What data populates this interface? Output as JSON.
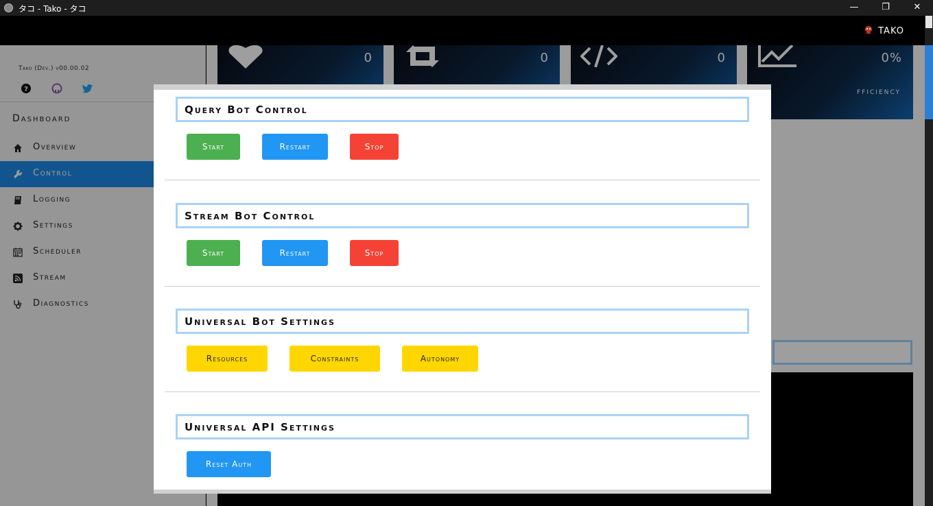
{
  "window": {
    "title": "タコ - Tako - タコ",
    "minimize": "—",
    "maximize": "❐",
    "close": "✕"
  },
  "topbar": {
    "brand": "TAKO"
  },
  "sidebar": {
    "version": "Tako (Dev.) v00.00.02",
    "dashboard_title": "Dashboard",
    "social_icons": [
      "help-icon",
      "github-icon",
      "twitter-icon"
    ],
    "items": [
      {
        "label": "Overview",
        "icon": "home-icon",
        "active": false
      },
      {
        "label": "Control",
        "icon": "wrench-icon",
        "active": true
      },
      {
        "label": "Logging",
        "icon": "book-icon",
        "active": false
      },
      {
        "label": "Settings",
        "icon": "gear-icon",
        "active": false
      },
      {
        "label": "Scheduler",
        "icon": "calendar-icon",
        "active": false
      },
      {
        "label": "Stream",
        "icon": "rss-icon",
        "active": false
      },
      {
        "label": "Diagnostics",
        "icon": "stethoscope-icon",
        "active": false
      }
    ]
  },
  "stats": [
    {
      "icon": "heart-icon",
      "value": "0",
      "label": ""
    },
    {
      "icon": "retweet-icon",
      "value": "0",
      "label": ""
    },
    {
      "icon": "code-icon",
      "value": "0",
      "label": ""
    },
    {
      "icon": "line-chart-icon",
      "value": "0%",
      "label": "fficiency"
    }
  ],
  "modal": {
    "sections": [
      {
        "title": "Query Bot Control",
        "buttons": [
          "Start",
          "Restart",
          "Stop"
        ]
      },
      {
        "title": "Stream Bot Control",
        "buttons": [
          "Start",
          "Restart",
          "Stop"
        ]
      },
      {
        "title": "Universal Bot Settings",
        "buttons": [
          "Resources",
          "Constraints",
          "Autonomy"
        ]
      },
      {
        "title": "Universal API Settings",
        "buttons": [
          "Reset Auth"
        ]
      }
    ]
  },
  "colors": {
    "accent": "#1e8ae6",
    "green": "#4caf50",
    "blue": "#2196f3",
    "red": "#f44336",
    "yellow": "#ffd600",
    "title_border": "#a9d3f5"
  }
}
